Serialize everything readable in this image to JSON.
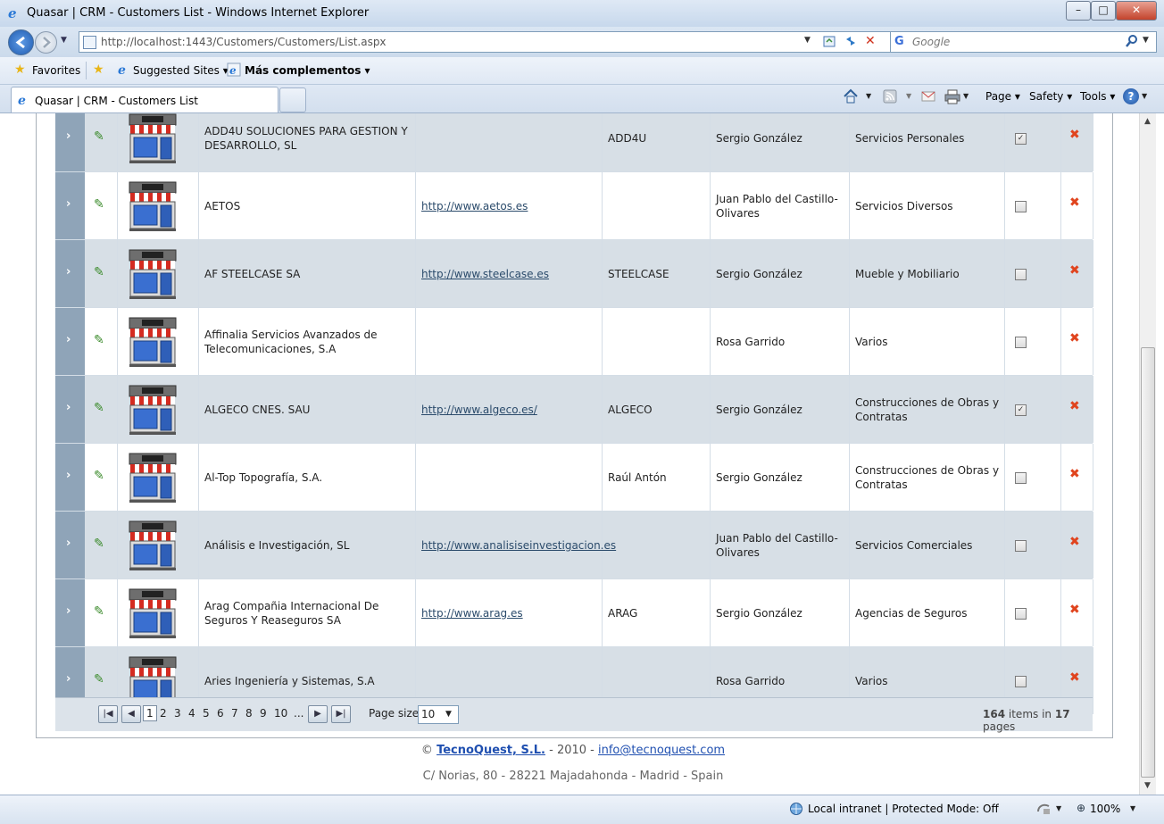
{
  "window": {
    "title": "Quasar | CRM - Customers List - Windows Internet Explorer",
    "minimize": "–",
    "maximize": "□",
    "close": "✕"
  },
  "address_bar": {
    "url": "http://localhost:1443/Customers/Customers/List.aspx",
    "search_brand": "G",
    "search_placeholder": "Google"
  },
  "favorites_bar": {
    "favorites": "Favorites",
    "suggested_sites": "Suggested Sites ▾",
    "more_addons": "Más complementos ▾"
  },
  "tabs": [
    {
      "label": "Quasar | CRM - Customers List"
    }
  ],
  "command_bar": {
    "page": "Page ▾",
    "safety": "Safety ▾",
    "tools": "Tools ▾",
    "help": "?"
  },
  "grid": {
    "rows": [
      {
        "name": "ADD4U SOLUCIONES PARA GESTION Y DESARROLLO, SL",
        "url": "",
        "code": "ADD4U",
        "owner": "Sergio González",
        "sector": "Servicios Personales",
        "checked": true,
        "check": "✓"
      },
      {
        "name": "AETOS",
        "url": "http://www.aetos.es",
        "code": "",
        "owner": "Juan Pablo del Castillo-Olivares",
        "sector": "Servicios Diversos",
        "checked": false,
        "check": ""
      },
      {
        "name": "AF STEELCASE SA",
        "url": "http://www.steelcase.es",
        "code": "STEELCASE",
        "owner": "Sergio González",
        "sector": "Mueble y Mobiliario",
        "checked": false,
        "check": ""
      },
      {
        "name": "Affinalia Servicios Avanzados de Telecomunicaciones, S.A",
        "url": "",
        "code": "",
        "owner": "Rosa Garrido",
        "sector": "Varios",
        "checked": false,
        "check": ""
      },
      {
        "name": "ALGECO CNES. SAU",
        "url": "http://www.algeco.es/",
        "code": "ALGECO",
        "owner": "Sergio González",
        "sector": "Construcciones de Obras y Contratas",
        "checked": true,
        "check": "✓"
      },
      {
        "name": "Al-Top Topografía, S.A.",
        "url": "",
        "code": "Raúl Antón",
        "owner": "Sergio González",
        "sector": "Construcciones de Obras y Contratas",
        "checked": false,
        "check": ""
      },
      {
        "name": "Análisis e Investigación, SL",
        "url": "http://www.analisiseinvestigacion.es",
        "code": "",
        "owner": "Juan Pablo del Castillo-Olivares",
        "sector": "Servicios Comerciales",
        "checked": false,
        "check": ""
      },
      {
        "name": "Arag Compañia Internacional De Seguros Y Reaseguros SA",
        "url": "http://www.arag.es",
        "code": "ARAG",
        "owner": "Sergio González",
        "sector": "Agencias de Seguros",
        "checked": false,
        "check": ""
      },
      {
        "name": "Aries Ingeniería y Sistemas, S.A",
        "url": "",
        "code": "",
        "owner": "Rosa Garrido",
        "sector": "Varios",
        "checked": false,
        "check": ""
      }
    ],
    "expand_glyph": "›",
    "edit_glyph": "✎",
    "delete_glyph": "✖"
  },
  "pager": {
    "first": "|◀",
    "prev": "◀",
    "next": "▶",
    "last": "▶|",
    "pages": [
      "1",
      "2",
      "3",
      "4",
      "5",
      "6",
      "7",
      "8",
      "9",
      "10",
      "..."
    ],
    "current_page": "1",
    "page_size_label": "Page size:",
    "page_size": "10",
    "total_items": "164",
    "items_in": "items in",
    "total_pages": "17",
    "pages_word": "pages"
  },
  "footer": {
    "copyright": "©",
    "company": "TecnoQuest, S.L.",
    "year": "- 2010 -",
    "email": "info@tecnoquest.com",
    "address": "C/ Norias, 80 - 28221 Majadahonda - Madrid - Spain"
  },
  "status_bar": {
    "zone": "Local intranet | Protected Mode: Off",
    "zoom": "100%"
  },
  "colors": {
    "row_alt": "#d7dfe6",
    "expander": "#8fa4b8",
    "delete": "#e0441e"
  }
}
